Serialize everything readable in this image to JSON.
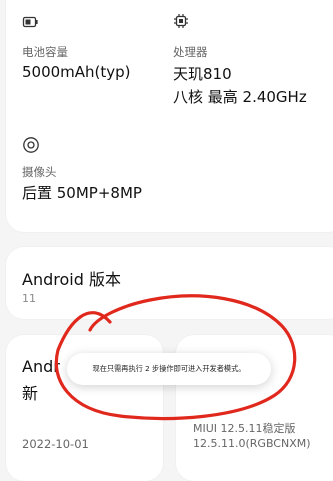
{
  "specs": {
    "battery": {
      "icon": "battery-icon",
      "label": "电池容量",
      "value": "5000mAh(typ)"
    },
    "processor": {
      "icon": "chip-icon",
      "label": "处理器",
      "value": "天玑810",
      "value2": "八核 最高 2.40GHz"
    },
    "camera": {
      "icon": "camera-icon",
      "label": "摄像头",
      "value": "后置 50MP+8MP"
    }
  },
  "android": {
    "title": "Android 版本",
    "value": "11"
  },
  "security": {
    "title_partial": "Andr",
    "title_line2": "新",
    "date": "2022-10-01"
  },
  "miui": {
    "line1": "MIUI 12.5.11稳定版",
    "line2": "12.5.11.0(RGBCNXM)"
  },
  "toast": {
    "message": "现在只需再执行 2 步操作即可进入开发者模式。"
  },
  "annotation": {
    "color": "#e0281d"
  }
}
